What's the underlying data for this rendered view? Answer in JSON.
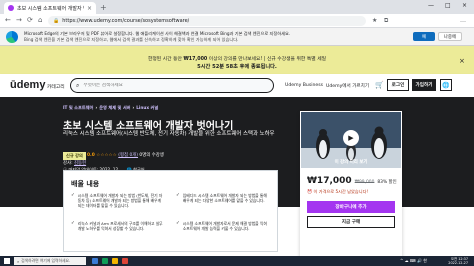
{
  "browser": {
    "tab_title": "초보 시스템 소프트웨어 개발자 벗어나기",
    "tab_close": "×",
    "new_tab": "+",
    "window_controls": [
      "—",
      "□",
      "×"
    ],
    "url": "https://www.udemy.com/course/sosystemsoftware/",
    "lock": "🔒",
    "nav": {
      "back": "←",
      "forward": "→",
      "reload": "⟳",
      "home": "⌂"
    },
    "toolbar_icons": [
      "★",
      "⧉",
      "…"
    ]
  },
  "edge_bar": {
    "line1": "Microsoft Edge의 기본 브라우저 및 PDF 뷰어로 설정합니다. 웹 애플리케이션 사이 해결책과 연결 Microsoft Bing과 기본 검색 엔진으로 지정하세요.",
    "line2": "Bing 검색 엔진을 기본 검색 엔진으로 지정하고, 웹에서 검색 결과를 신속하고 정확하게 찾아 확인 가능하게 되어 있습니다.",
    "primary_button": "예",
    "secondary_button": "나중에"
  },
  "promo": {
    "line1_pre": "한정된 시간 동안 ",
    "line1_bold": "₩17,000",
    "line1_post": " 이상의 강의를 만나보세요! | 신규 수강생을 위한 특별 세일",
    "line2": "5시간 52분 58초 후에 종료됩니다.",
    "close": "×"
  },
  "udemy_header": {
    "logo": "ūdemy",
    "categories": "카테고리",
    "search_placeholder": "무엇이든 검색하세요",
    "business": "Udemy Business",
    "teach": "Udemy에서 가르치기",
    "cart": "🛒",
    "login": "로그인",
    "signup": "가입하기",
    "lang": "🌐"
  },
  "course": {
    "breadcrumb": [
      "IT 및 소프트웨어",
      "운영 체제 및 서버",
      "Linux 커널"
    ],
    "breadcrumb_sep": "›",
    "title": "초보 시스템 소프트웨어 개발자 벗어나기",
    "subtitle": "리눅스 시스템 소프트웨어(시스템 반도체, 전기 자동차) 개발을 위한 소프트웨어 스택과 노하우",
    "badge": "신규 강의",
    "rating_value": "0.0",
    "stars": "☆☆☆☆☆",
    "rating_count": "(평점 0개)",
    "students": "0명의 수강생",
    "creator_label": "강사: ",
    "instructor": "김동현",
    "meta_updated": "ⓘ 마지막 업데이트: 2022. 12.",
    "meta_lang": "🌐 한국어"
  },
  "card": {
    "preview_label": "이 강의 미리 보기",
    "play": "▶",
    "price": "₩17,000",
    "original_price": "₩99,000",
    "discount": "83% 할인",
    "timer": "⏰ 이 가격으로 5시간 남았습니다!",
    "add_to_cart": "장바구니에 추가",
    "buy_now": "지금 구매"
  },
  "learn": {
    "title": "배울 내용",
    "check": "✓",
    "items": [
      "시스템 소프트웨어 개발자 되는 방법 (반도체, 전기 자동차 등) 소프트웨어 개발자 되는 방법을 통해 배우게 되는 데이터를 맡을 수 있습니다.",
      "임베디드 시스템 소프트웨어 개발자 되는 방법을 통해 배우게 되는 다양한 소프트웨어를 맡을 수 있습니다.",
      "리눅스 커널과 Arm 프로세서의 구조를 이해하고 실무 개발 노하우를 익혀서 성장할 수 있습니다.",
      "시스템 소프트웨어 개발자로서 문제 해결 방법을 익혀 소프트웨어 개발 능력을 키울 수 있습니다."
    ]
  },
  "taskbar": {
    "search_placeholder": "검색하려면 여기에 입력하세요.",
    "tray": "^ ☁ ⌨ 🔊 한",
    "time": "오전 12:37",
    "date": "2022-12-27"
  },
  "colors": {
    "udemy_purple": "#a435f0",
    "promo_yellow": "#eceb98",
    "hero_dark": "#1c1d1f",
    "rating_orange": "#f69c08"
  }
}
